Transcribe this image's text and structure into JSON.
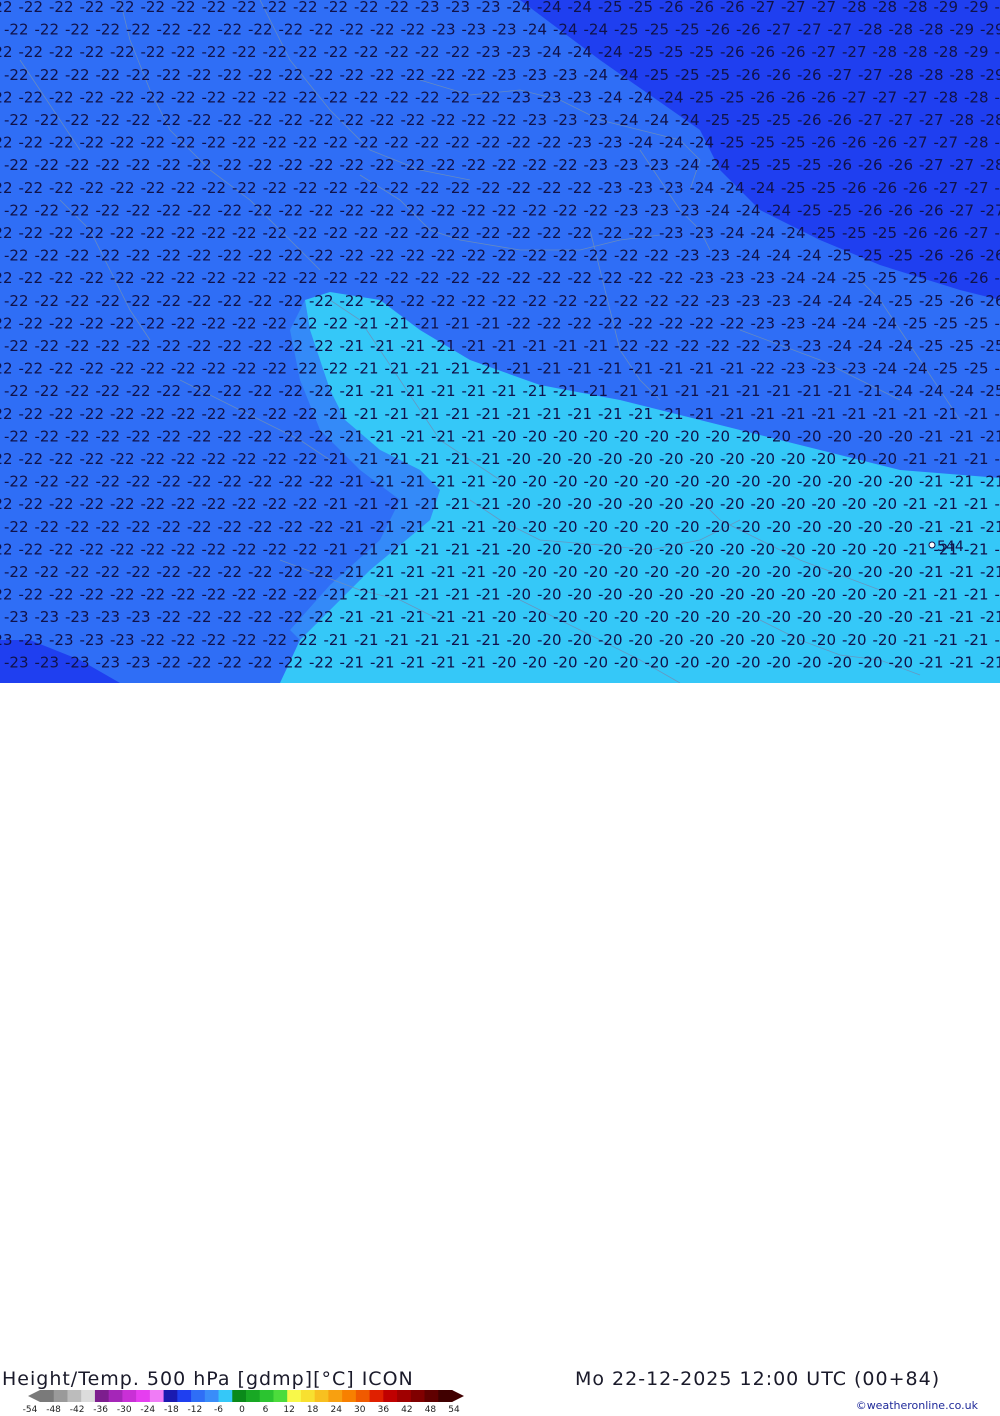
{
  "map": {
    "title": "Height/Temp. 500 hPa [gdmp][°C] ICON",
    "datetime": "Mo 22-12-2025 12:00 UTC (00+84)",
    "credit": "©weatheronline.co.uk",
    "marker_label": "544",
    "colors": {
      "deep": "#1f3ff0",
      "base": "#2f6ef6",
      "mid": "#3a8df9",
      "light": "#35c8f8",
      "label": "#10124a",
      "border": "#6f8fb8"
    },
    "temperature_labels": [
      "-20",
      "-21",
      "-22",
      "-23",
      "-24",
      "-25",
      "-26",
      "-27",
      "-28",
      "-29"
    ]
  },
  "legend": {
    "ticks": [
      "-54",
      "-48",
      "-42",
      "-36",
      "-30",
      "-24",
      "-18",
      "-12",
      "-6",
      "0",
      "6",
      "12",
      "18",
      "24",
      "30",
      "36",
      "42",
      "48",
      "54"
    ],
    "swatches": [
      "#7a7a7a",
      "#9a9a9a",
      "#bcbcbc",
      "#dcdcdc",
      "#7d1e8e",
      "#a526b8",
      "#c930d6",
      "#e63ef0",
      "#f07cf6",
      "#1a1ab0",
      "#1f3ff0",
      "#2f6ef6",
      "#3a8df9",
      "#35c8f8",
      "#0a8a1a",
      "#18a824",
      "#2bc430",
      "#4cdc3c",
      "#f8f84a",
      "#f8e030",
      "#f8c020",
      "#f8a010",
      "#f88000",
      "#f05a00",
      "#e02000",
      "#c00000",
      "#a00000",
      "#800000",
      "#600000",
      "#400000"
    ]
  }
}
